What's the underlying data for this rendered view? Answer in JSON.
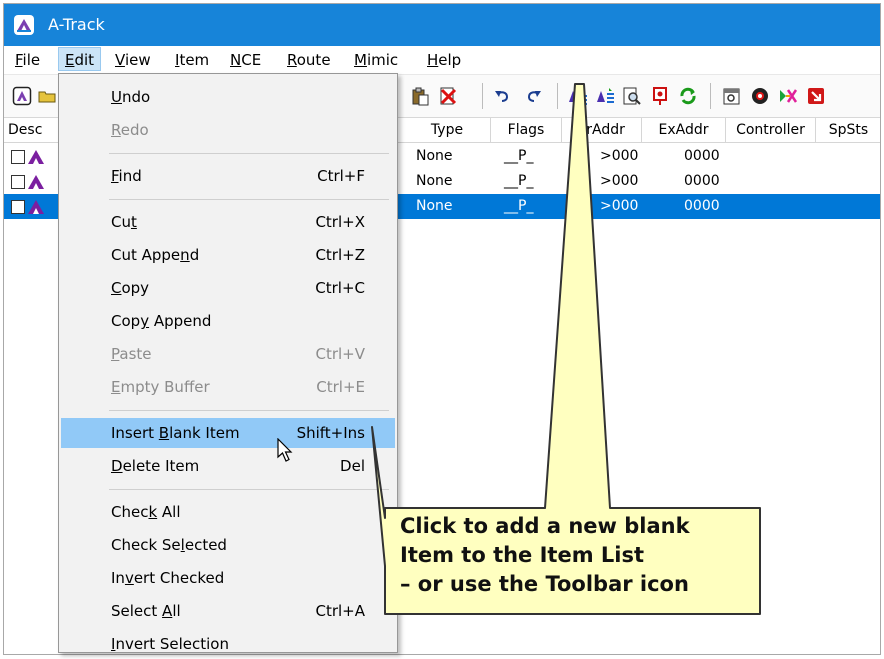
{
  "window": {
    "title": "A-Track",
    "app_icon": "a-track-logo-icon",
    "titlebar_color": "#1784d9"
  },
  "menubar": {
    "items": [
      {
        "label": "File",
        "ul": "F",
        "rest": "ile"
      },
      {
        "label": "Edit",
        "ul": "E",
        "rest": "dit"
      },
      {
        "label": "View",
        "ul": "V",
        "rest": "iew"
      },
      {
        "label": "Item",
        "ul": "I",
        "rest": "tem"
      },
      {
        "label": "NCE",
        "ul": "N",
        "rest": "CE"
      },
      {
        "label": "Route",
        "ul": "R",
        "rest": "oute"
      },
      {
        "label": "Mimic",
        "ul": "M",
        "rest": "imic"
      },
      {
        "label": "Help",
        "ul": "H",
        "rest": "elp"
      }
    ],
    "open_menu": "Edit"
  },
  "toolbar": {
    "icons": [
      "a-track-icon",
      "open-folder-icon",
      "paste-icon",
      "delete-icon",
      "undo-icon",
      "redo-icon",
      "insert-blank-item-icon",
      "insert-item-icon",
      "find-icon",
      "signal-icon",
      "refresh-icon",
      "properties-icon",
      "route-icon",
      "mimic-icon",
      "exit-icon"
    ]
  },
  "list": {
    "columns": [
      "Desc",
      "Type",
      "Flags",
      "PrAddr",
      "ExAddr",
      "Controller",
      "SpSts"
    ],
    "rows": [
      {
        "type": "None",
        "flags": "__P_",
        "praddr": ">000",
        "exaddr": "0000",
        "selected": false
      },
      {
        "type": "None",
        "flags": "__P_",
        "praddr": ">000",
        "exaddr": "0000",
        "selected": false
      },
      {
        "type": "None",
        "flags": "__P_",
        "praddr": ">000",
        "exaddr": "0000",
        "selected": true
      }
    ],
    "selection_color": "#0078d7"
  },
  "edit_menu": {
    "groups": [
      [
        {
          "pre": "",
          "ul": "U",
          "post": "ndo",
          "shortcut": "",
          "disabled": false
        },
        {
          "pre": "",
          "ul": "R",
          "post": "edo",
          "shortcut": "",
          "disabled": true
        }
      ],
      [
        {
          "pre": "",
          "ul": "F",
          "post": "ind",
          "shortcut": "Ctrl+F",
          "disabled": false
        }
      ],
      [
        {
          "pre": "Cu",
          "ul": "t",
          "post": "",
          "shortcut": "Ctrl+X",
          "disabled": false
        },
        {
          "pre": "Cut Appe",
          "ul": "n",
          "post": "d",
          "shortcut": "Ctrl+Z",
          "disabled": false
        },
        {
          "pre": "",
          "ul": "C",
          "post": "opy",
          "shortcut": "Ctrl+C",
          "disabled": false
        },
        {
          "pre": "Cop",
          "ul": "y",
          "post": " Append",
          "shortcut": "",
          "disabled": false
        },
        {
          "pre": "",
          "ul": "P",
          "post": "aste",
          "shortcut": "Ctrl+V",
          "disabled": true
        },
        {
          "pre": "",
          "ul": "E",
          "post": "mpty Buffer",
          "shortcut": "Ctrl+E",
          "disabled": true
        }
      ],
      [
        {
          "pre": "Insert ",
          "ul": "B",
          "post": "lank Item",
          "shortcut": "Shift+Ins",
          "disabled": false,
          "highlighted": true
        },
        {
          "pre": "",
          "ul": "D",
          "post": "elete Item",
          "shortcut": "Del",
          "disabled": false
        }
      ],
      [
        {
          "pre": "Chec",
          "ul": "k",
          "post": " All",
          "shortcut": "",
          "disabled": false
        },
        {
          "pre": "Check Se",
          "ul": "l",
          "post": "ected",
          "shortcut": "",
          "disabled": false
        },
        {
          "pre": "In",
          "ul": "v",
          "post": "ert Checked",
          "shortcut": "",
          "disabled": false
        },
        {
          "pre": "Select ",
          "ul": "A",
          "post": "ll",
          "shortcut": "Ctrl+A",
          "disabled": false
        },
        {
          "pre": "",
          "ul": "I",
          "post": "nvert Selection",
          "shortcut": "",
          "disabled": false
        }
      ]
    ],
    "highlight_color": "#91c9f7"
  },
  "callout": {
    "lines": [
      "Click to add a new blank",
      "Item to the Item List",
      "– or use the Toolbar icon"
    ],
    "fill": "#ffffc0",
    "border": "#333333"
  }
}
